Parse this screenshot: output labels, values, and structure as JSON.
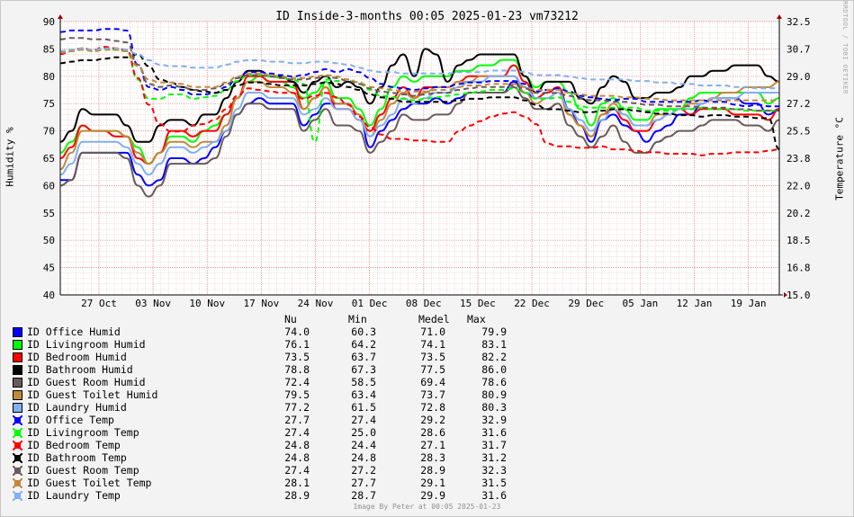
{
  "title": "ID_Inside-3-months 00:05 2025-01-23 vm73212",
  "ylabel_left": "Humidity %",
  "ylabel_right": "Temperature °C",
  "watermark": "RRDTOOL / TOBI OETIKER",
  "footer": "Image By Peter at 00:05 2025-01-23",
  "stats_headers": [
    "Nu",
    "Min",
    "Medel",
    "Max"
  ],
  "chart_data": {
    "type": "line",
    "title": "ID_Inside-3-months 00:05 2025-01-23 vm73212",
    "x_ticks": [
      "27 Oct",
      "03 Nov",
      "10 Nov",
      "17 Nov",
      "24 Nov",
      "01 Dec",
      "08 Dec",
      "15 Dec",
      "22 Dec",
      "29 Dec",
      "05 Jan",
      "12 Jan",
      "19 Jan"
    ],
    "x_range": [
      "2024-10-22",
      "2025-01-23"
    ],
    "ylabel": "Humidity %",
    "ylim": [
      40,
      90
    ],
    "yticks": [
      40,
      45,
      50,
      55,
      60,
      65,
      70,
      75,
      80,
      85,
      90
    ],
    "ylabel_right": "Temperature °C",
    "ylim_right": [
      15.0,
      33.4
    ],
    "yticks_right": [
      "15.0",
      "16.8",
      "18.5",
      "20.2",
      "22.0",
      "23.8",
      "25.5",
      "27.2",
      "29.0",
      "30.7",
      "32.5"
    ],
    "grid": true,
    "legend_position": "bottom",
    "series": [
      {
        "name": "ID Office Humid",
        "color": "#0000ff",
        "style": "solid",
        "nu": "74.0",
        "min": "60.3",
        "medel": "71.0",
        "max": "79.9",
        "values": [
          61,
          61,
          66,
          66,
          66,
          66,
          66,
          62,
          60,
          61,
          65,
          65,
          64,
          65,
          67,
          70,
          73,
          75,
          76,
          75,
          75,
          75,
          71,
          73,
          75,
          75,
          75,
          73,
          67,
          70,
          72,
          74,
          75,
          75,
          76,
          75,
          76,
          77,
          77,
          77,
          77,
          79,
          77,
          76,
          77,
          78,
          74,
          71,
          68,
          72,
          73,
          71,
          70,
          68,
          70,
          71,
          73,
          73,
          75,
          76,
          76,
          76,
          75,
          75,
          73,
          74
        ]
      },
      {
        "name": "ID Livingroom Humid",
        "color": "#00ff00",
        "style": "solid",
        "nu": "76.1",
        "min": "64.2",
        "medel": "74.1",
        "max": "83.1",
        "values": [
          66,
          68,
          71,
          70,
          70,
          70,
          69,
          67,
          64,
          66,
          69,
          69,
          68,
          70,
          71,
          73,
          76,
          79,
          80,
          79,
          79,
          78,
          76,
          77,
          79,
          76,
          76,
          74,
          71,
          74,
          78,
          80,
          79,
          80,
          80,
          80,
          81,
          81,
          82,
          82,
          83,
          83,
          80,
          78,
          79,
          79,
          77,
          74,
          71,
          75,
          76,
          74,
          72,
          72,
          74,
          74,
          74,
          76,
          77,
          77,
          77,
          77,
          77,
          77,
          75,
          76
        ]
      },
      {
        "name": "ID Bedroom Humid",
        "color": "#ff0000",
        "style": "solid",
        "nu": "73.5",
        "min": "63.7",
        "medel": "73.5",
        "max": "82.2",
        "values": [
          65,
          67,
          71,
          70,
          70,
          69,
          69,
          65,
          64,
          66,
          70,
          70,
          69,
          70,
          70,
          73,
          76,
          80,
          80,
          79,
          79,
          79,
          74,
          76,
          78,
          74,
          74,
          72,
          70,
          73,
          76,
          78,
          76,
          78,
          78,
          78,
          79,
          80,
          80,
          80,
          80,
          82,
          79,
          76,
          77,
          78,
          73,
          71,
          69,
          73,
          74,
          72,
          70,
          70,
          72,
          73,
          74,
          73,
          74,
          74,
          74,
          73,
          73,
          73,
          72,
          74
        ]
      },
      {
        "name": "ID Bathroom Humid",
        "color": "#000000",
        "style": "solid",
        "nu": "78.8",
        "min": "67.3",
        "medel": "77.5",
        "max": "86.0",
        "values": [
          68,
          70,
          74,
          73,
          73,
          73,
          71,
          68,
          68,
          71,
          72,
          72,
          71,
          73,
          73,
          76,
          79,
          81,
          81,
          80,
          80,
          79,
          77,
          79,
          80,
          78,
          79,
          78,
          75,
          78,
          82,
          84,
          80,
          85,
          84,
          79,
          82,
          83,
          84,
          84,
          84,
          84,
          80,
          77,
          79,
          79,
          79,
          76,
          75,
          78,
          80,
          79,
          76,
          76,
          77,
          77,
          78,
          80,
          80,
          81,
          81,
          82,
          82,
          82,
          80,
          79
        ]
      },
      {
        "name": "ID Guest Room Humid",
        "color": "#6a5a5a",
        "style": "solid",
        "nu": "72.4",
        "min": "58.5",
        "medel": "69.4",
        "max": "78.6",
        "values": [
          60,
          61,
          66,
          66,
          66,
          66,
          65,
          60,
          58,
          60,
          64,
          64,
          64,
          64,
          65,
          69,
          73,
          75,
          75,
          74,
          74,
          74,
          70,
          72,
          74,
          71,
          71,
          70,
          66,
          68,
          70,
          73,
          72,
          72,
          73,
          73,
          75,
          77,
          77,
          77,
          77,
          78,
          76,
          74,
          74,
          75,
          71,
          69,
          67,
          69,
          71,
          68,
          66,
          66,
          68,
          69,
          70,
          70,
          71,
          72,
          72,
          72,
          71,
          71,
          70,
          72
        ]
      },
      {
        "name": "ID Guest Toilet Humid",
        "color": "#c08a3a",
        "style": "solid",
        "nu": "79.5",
        "min": "63.4",
        "medel": "73.7",
        "max": "80.9",
        "values": [
          63,
          66,
          70,
          70,
          70,
          70,
          69,
          66,
          64,
          66,
          68,
          68,
          67,
          68,
          68,
          71,
          76,
          79,
          79,
          78,
          78,
          77,
          74,
          76,
          78,
          75,
          75,
          73,
          69,
          72,
          75,
          77,
          76,
          77,
          78,
          78,
          79,
          79,
          80,
          80,
          80,
          80,
          77,
          75,
          76,
          77,
          73,
          71,
          69,
          73,
          75,
          73,
          71,
          71,
          73,
          73,
          74,
          75,
          75,
          76,
          77,
          77,
          78,
          78,
          78,
          79
        ]
      },
      {
        "name": "ID Laundry Humid",
        "color": "#80b0f0",
        "style": "solid",
        "nu": "77.2",
        "min": "61.5",
        "medel": "72.8",
        "max": "80.3",
        "values": [
          62,
          64,
          68,
          68,
          68,
          68,
          67,
          64,
          62,
          64,
          67,
          67,
          66,
          67,
          68,
          70,
          74,
          77,
          77,
          76,
          76,
          76,
          73,
          74,
          76,
          74,
          74,
          72,
          69,
          71,
          73,
          76,
          75,
          76,
          77,
          77,
          78,
          79,
          79,
          80,
          80,
          80,
          78,
          76,
          76,
          77,
          74,
          72,
          70,
          72,
          74,
          73,
          71,
          71,
          72,
          73,
          74,
          74,
          75,
          76,
          76,
          76,
          77,
          77,
          77,
          77
        ]
      },
      {
        "name": "ID Office Temp",
        "color": "#0000ff",
        "style": "dashed",
        "nu": "27.7",
        "min": "27.4",
        "medel": "29.2",
        "max": "32.9",
        "values": [
          32.7,
          32.8,
          32.8,
          32.8,
          32.9,
          32.9,
          32.8,
          30.5,
          29.0,
          28.8,
          29.0,
          28.8,
          28.5,
          28.5,
          28.6,
          29.0,
          29.6,
          30.0,
          30.0,
          29.9,
          29.8,
          29.7,
          29.8,
          30.0,
          30.2,
          30.0,
          30.2,
          30.0,
          29.6,
          29.2,
          29.0,
          28.9,
          28.8,
          28.9,
          29.0,
          29.0,
          29.2,
          29.3,
          29.3,
          29.4,
          29.4,
          29.4,
          29.2,
          28.7,
          28.8,
          28.9,
          28.7,
          28.4,
          28.3,
          28.2,
          28.1,
          28.2,
          28.2,
          28.0,
          28.0,
          28.0,
          28.0,
          28.0,
          28.1,
          28.0,
          28.0,
          27.8,
          27.7,
          27.8,
          27.7,
          27.7
        ]
      },
      {
        "name": "ID Livingroom Temp",
        "color": "#00ff00",
        "style": "dashed",
        "nu": "27.4",
        "min": "25.0",
        "medel": "28.6",
        "max": "31.6",
        "values": [
          31.3,
          31.5,
          31.6,
          31.4,
          31.6,
          31.5,
          31.4,
          29.5,
          28.2,
          28.2,
          28.5,
          28.5,
          28.2,
          28.3,
          28.4,
          28.8,
          29.4,
          29.8,
          29.8,
          29.7,
          29.6,
          29.5,
          29.2,
          25.3,
          29.5,
          29.4,
          29.5,
          29.3,
          28.8,
          28.4,
          28.3,
          28.2,
          28.1,
          28.2,
          28.3,
          28.4,
          28.5,
          28.6,
          28.7,
          28.8,
          28.8,
          28.9,
          28.6,
          28.2,
          28.2,
          28.3,
          28.0,
          27.7,
          27.6,
          27.6,
          27.6,
          27.6,
          27.6,
          27.4,
          27.4,
          27.4,
          27.5,
          27.5,
          27.6,
          27.5,
          27.5,
          27.5,
          27.4,
          27.4,
          27.4,
          27.4
        ]
      },
      {
        "name": "ID Bedroom Temp",
        "color": "#ff0000",
        "style": "dashed",
        "nu": "24.8",
        "min": "24.4",
        "medel": "27.1",
        "max": "31.7",
        "values": [
          31.2,
          31.4,
          31.6,
          31.5,
          31.7,
          31.6,
          31.5,
          29.6,
          27.8,
          26.5,
          26.0,
          26.0,
          26.4,
          26.5,
          26.8,
          27.5,
          28.4,
          28.9,
          28.8,
          28.7,
          28.6,
          28.6,
          28.2,
          28.4,
          28.6,
          28.3,
          27.8,
          27.0,
          26.3,
          25.8,
          25.5,
          25.5,
          25.4,
          25.4,
          25.3,
          25.3,
          26.0,
          26.4,
          26.7,
          27.0,
          27.2,
          27.3,
          27.0,
          26.5,
          25.2,
          25.0,
          25.0,
          24.9,
          24.9,
          25.0,
          24.8,
          24.8,
          24.7,
          24.6,
          24.6,
          24.5,
          24.5,
          24.5,
          24.4,
          24.5,
          24.5,
          24.6,
          24.6,
          24.6,
          24.7,
          24.8
        ]
      },
      {
        "name": "ID Bathroom Temp",
        "color": "#000000",
        "style": "dashed",
        "nu": "24.8",
        "min": "24.8",
        "medel": "28.3",
        "max": "31.2",
        "values": [
          30.6,
          30.7,
          30.8,
          30.8,
          30.9,
          31.0,
          31.0,
          31.2,
          30.4,
          29.5,
          29.3,
          29.0,
          28.8,
          28.7,
          28.6,
          28.8,
          29.1,
          29.3,
          29.3,
          29.2,
          29.1,
          29.1,
          29.1,
          29.2,
          29.3,
          29.2,
          29.0,
          28.8,
          28.5,
          28.3,
          28.2,
          28.0,
          28.0,
          28.0,
          28.0,
          28.0,
          28.1,
          28.2,
          28.2,
          28.3,
          28.3,
          28.3,
          28.1,
          27.8,
          27.5,
          27.5,
          27.4,
          27.3,
          27.3,
          27.4,
          27.5,
          27.5,
          27.4,
          27.3,
          27.2,
          27.2,
          27.1,
          27.1,
          27.0,
          27.1,
          27.1,
          27.0,
          27.0,
          26.9,
          26.9,
          24.8
        ]
      },
      {
        "name": "ID Guest Room Temp",
        "color": "#6a5a5a",
        "style": "dashed",
        "nu": "27.4",
        "min": "27.2",
        "medel": "28.9",
        "max": "32.3",
        "values": [
          32.2,
          32.3,
          32.3,
          32.2,
          32.2,
          32.1,
          32.0,
          30.5,
          29.2,
          29.0,
          29.1,
          29.0,
          28.8,
          28.8,
          28.9,
          29.2,
          29.6,
          29.8,
          29.8,
          29.7,
          29.6,
          29.5,
          29.5,
          29.6,
          29.7,
          29.6,
          29.4,
          29.2,
          28.9,
          28.7,
          28.6,
          28.5,
          28.4,
          28.5,
          28.6,
          28.6,
          28.8,
          28.9,
          29.0,
          29.0,
          29.0,
          29.1,
          28.9,
          28.6,
          28.6,
          28.6,
          28.4,
          28.2,
          28.1,
          28.1,
          28.0,
          28.0,
          27.9,
          27.8,
          27.8,
          27.7,
          27.7,
          27.7,
          27.6,
          27.6,
          27.6,
          27.5,
          27.5,
          27.4,
          27.4,
          27.4
        ]
      },
      {
        "name": "ID Guest Toilet Temp",
        "color": "#c08a3a",
        "style": "dashed",
        "nu": "28.1",
        "min": "27.7",
        "medel": "29.1",
        "max": "31.5",
        "values": [
          31.3,
          31.4,
          31.5,
          31.4,
          31.5,
          31.5,
          31.4,
          30.4,
          29.5,
          29.3,
          29.3,
          29.2,
          29.0,
          29.0,
          29.0,
          29.3,
          29.7,
          29.9,
          29.9,
          29.8,
          29.7,
          29.6,
          29.6,
          29.7,
          29.8,
          29.7,
          29.5,
          29.3,
          29.0,
          28.9,
          28.8,
          28.7,
          28.7,
          28.7,
          28.8,
          28.8,
          29.0,
          29.1,
          29.1,
          29.2,
          29.2,
          29.2,
          29.0,
          28.8,
          28.8,
          28.8,
          28.6,
          28.5,
          28.4,
          28.4,
          28.4,
          28.3,
          28.3,
          28.2,
          28.2,
          28.1,
          28.1,
          28.1,
          28.1,
          28.1,
          28.1,
          28.1,
          28.1,
          28.1,
          28.1,
          28.1
        ]
      },
      {
        "name": "ID Laundry Temp",
        "color": "#80b0f0",
        "style": "dashed",
        "nu": "28.9",
        "min": "28.7",
        "medel": "29.9",
        "max": "31.6",
        "values": [
          31.4,
          31.5,
          31.6,
          31.5,
          31.6,
          31.6,
          31.5,
          31.2,
          30.8,
          30.5,
          30.4,
          30.4,
          30.3,
          30.3,
          30.3,
          30.5,
          30.7,
          30.8,
          30.8,
          30.7,
          30.7,
          30.6,
          30.6,
          30.7,
          30.7,
          30.6,
          30.5,
          30.3,
          30.1,
          30.0,
          30.0,
          29.9,
          29.9,
          29.9,
          29.9,
          29.9,
          30.0,
          30.0,
          30.0,
          30.1,
          30.1,
          30.1,
          30.0,
          29.8,
          29.8,
          29.8,
          29.7,
          29.6,
          29.5,
          29.5,
          29.5,
          29.5,
          29.4,
          29.4,
          29.3,
          29.3,
          29.2,
          29.2,
          29.1,
          29.1,
          29.1,
          29.0,
          29.0,
          28.9,
          28.9,
          28.9
        ]
      }
    ]
  }
}
